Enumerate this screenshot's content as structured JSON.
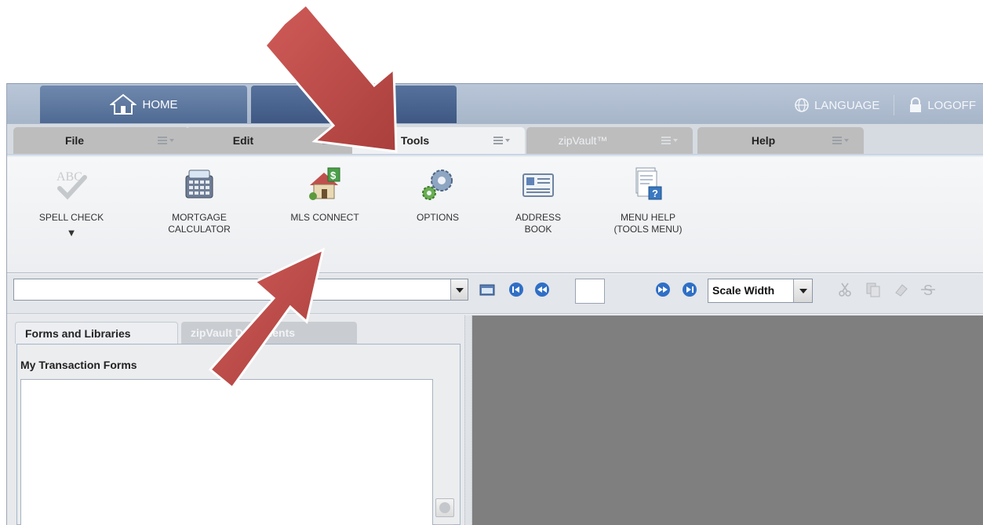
{
  "topbar": {
    "home_label": "HOME",
    "language_label": "LANGUAGE",
    "logoff_label": "LOGOFF"
  },
  "menu_tabs": [
    {
      "label": "File"
    },
    {
      "label": "Edit"
    },
    {
      "label": "Tools"
    },
    {
      "label": "zipVault™"
    },
    {
      "label": "Help"
    }
  ],
  "ribbon": [
    {
      "label": "SPELL CHECK",
      "sub": "▼",
      "icon": "spell-check-icon"
    },
    {
      "label": "MORTGAGE",
      "sub": "CALCULATOR",
      "icon": "calculator-icon"
    },
    {
      "label": "MLS CONNECT",
      "sub": "",
      "icon": "house-icon"
    },
    {
      "label": "OPTIONS",
      "sub": "",
      "icon": "gears-icon"
    },
    {
      "label": "ADDRESS",
      "sub": "BOOK",
      "icon": "address-card-icon"
    },
    {
      "label": "MENU HELP",
      "sub": "(TOOLS MENU)",
      "icon": "help-document-icon"
    }
  ],
  "toolbar": {
    "scale_value": "Scale Width",
    "page_value": ""
  },
  "left_panel": {
    "tabs": [
      {
        "label": "Forms and Libraries"
      },
      {
        "label": "zipVault Documents"
      }
    ],
    "section_title": "My Transaction Forms"
  },
  "colors": {
    "arrow": "#c0504d",
    "canvas": "#7f7f7f",
    "topbar": "#a7b5c9"
  }
}
